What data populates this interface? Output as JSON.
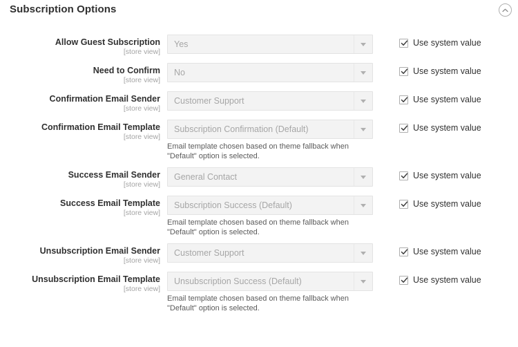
{
  "section": {
    "title": "Subscription Options",
    "collapse_icon": "chevron-up-circle-icon"
  },
  "common": {
    "scope_label": "[store view]",
    "use_system_value_label": "Use system value",
    "dropdown_icon": "chevron-down-icon",
    "checkbox_icon": "check-icon",
    "template_hint": "Email template chosen based on theme fallback when \"Default\" option is selected."
  },
  "colors": {
    "text": "#303030",
    "muted": "#a3a3a3",
    "field_bg": "#f3f3f3",
    "field_border": "#e3e3e3",
    "placeholder": "#a6a6a6"
  },
  "fields": [
    {
      "label": "Allow Guest Subscription",
      "scope": "[store view]",
      "value": "Yes",
      "hint": "",
      "use_system_value": true
    },
    {
      "label": "Need to Confirm",
      "scope": "[store view]",
      "value": "No",
      "hint": "",
      "use_system_value": true
    },
    {
      "label": "Confirmation Email Sender",
      "scope": "[store view]",
      "value": "Customer Support",
      "hint": "",
      "use_system_value": true
    },
    {
      "label": "Confirmation Email Template",
      "scope": "[store view]",
      "value": "Subscription Confirmation (Default)",
      "hint": "Email template chosen based on theme fallback when \"Default\" option is selected.",
      "use_system_value": true
    },
    {
      "label": "Success Email Sender",
      "scope": "[store view]",
      "value": "General Contact",
      "hint": "",
      "use_system_value": true
    },
    {
      "label": "Success Email Template",
      "scope": "[store view]",
      "value": "Subscription Success (Default)",
      "hint": "Email template chosen based on theme fallback when \"Default\" option is selected.",
      "use_system_value": true
    },
    {
      "label": "Unsubscription Email Sender",
      "scope": "[store view]",
      "value": "Customer Support",
      "hint": "",
      "use_system_value": true
    },
    {
      "label": "Unsubscription Email Template",
      "scope": "[store view]",
      "value": "Unsubscription Success (Default)",
      "hint": "Email template chosen based on theme fallback when \"Default\" option is selected.",
      "use_system_value": true
    }
  ]
}
